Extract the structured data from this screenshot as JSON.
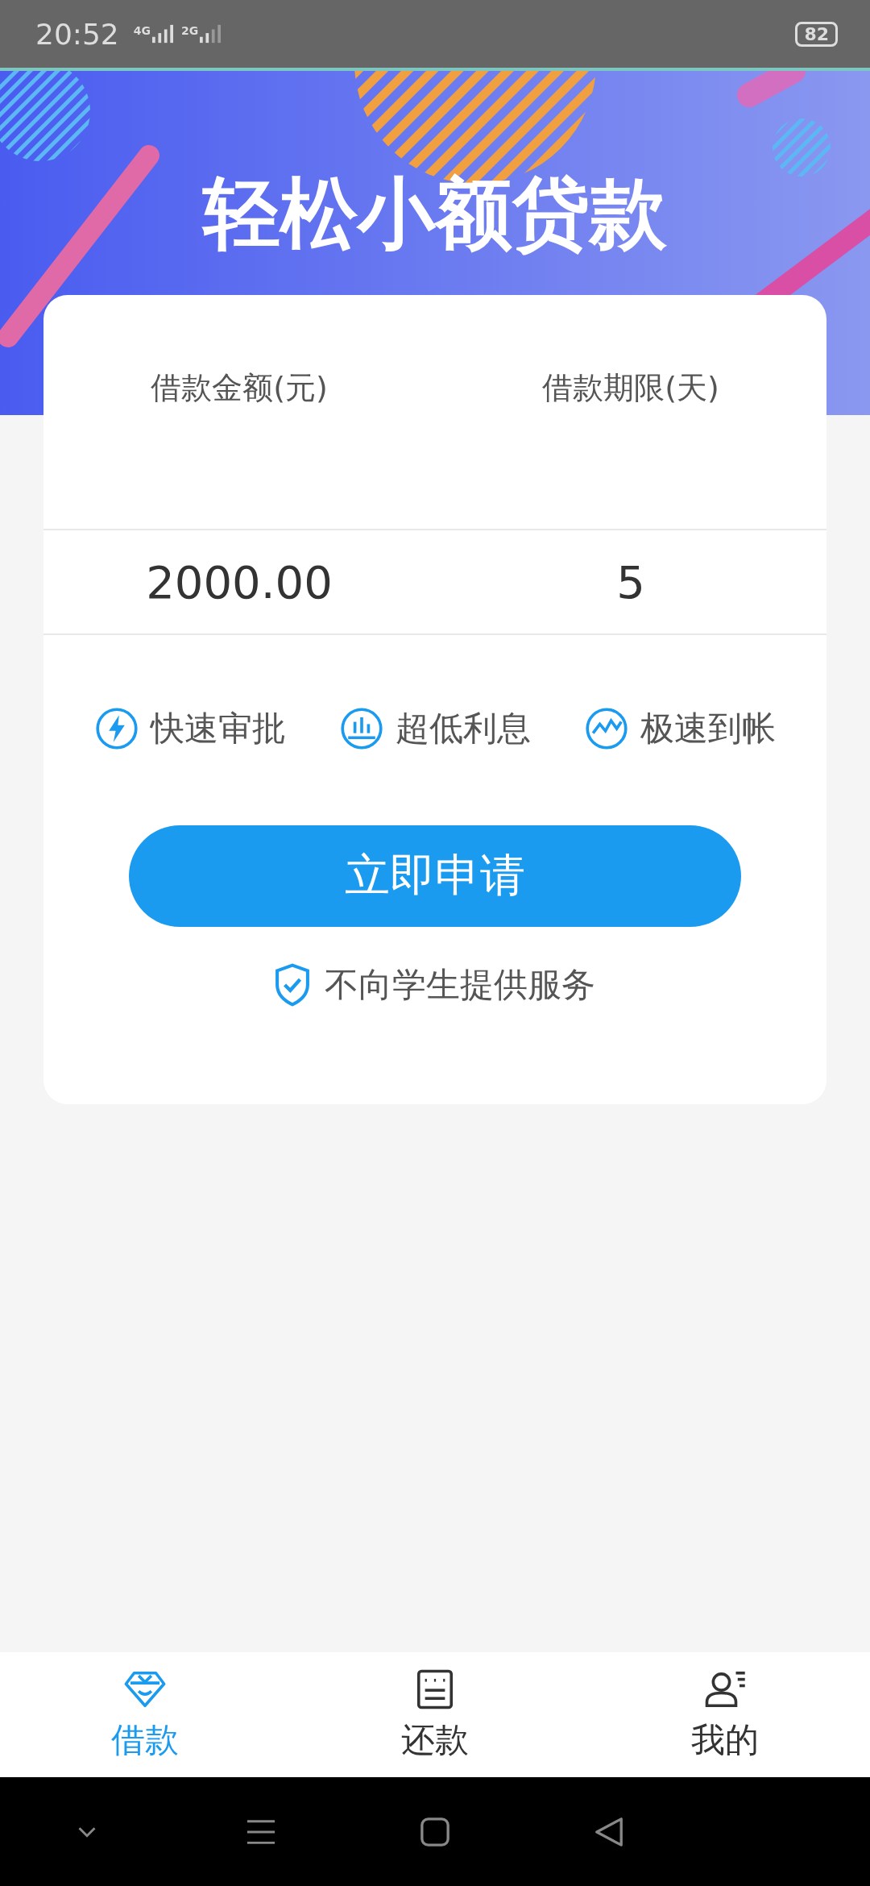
{
  "status_bar": {
    "time": "20:52",
    "networks": [
      "4G",
      "2G"
    ],
    "battery": "82"
  },
  "banner": {
    "title": "轻松小额贷款"
  },
  "loan_form": {
    "fields": [
      {
        "label": "借款金额(元)",
        "value": "2000.00"
      },
      {
        "label": "借款期限(天)",
        "value": "5"
      }
    ]
  },
  "features": [
    {
      "kind": "lightning",
      "label": "快速审批"
    },
    {
      "kind": "bars",
      "label": "超低利息"
    },
    {
      "kind": "wave",
      "label": "极速到帐"
    }
  ],
  "apply_button": "立即申请",
  "notice": "不向学生提供服务",
  "tabs": [
    {
      "kind": "diamond",
      "label": "借款",
      "selected": true
    },
    {
      "kind": "list",
      "label": "还款",
      "selected": false
    },
    {
      "kind": "person",
      "label": "我的",
      "selected": false
    }
  ]
}
